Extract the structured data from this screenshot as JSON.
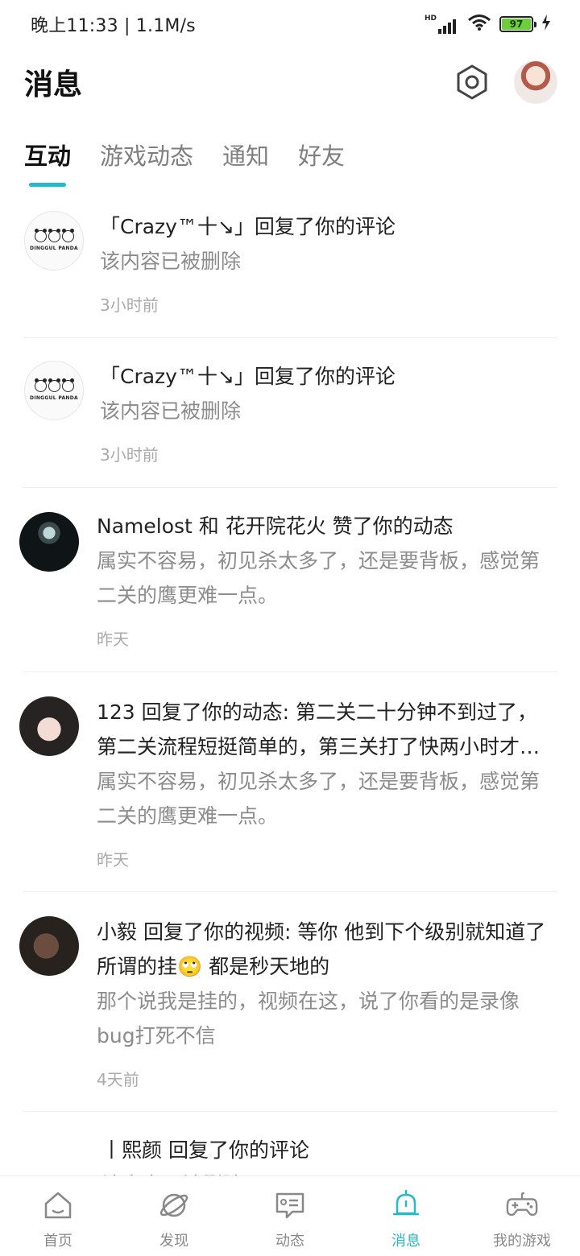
{
  "status_bar": {
    "time_speed": "晚上11:33 | 1.1M/s",
    "signal_label": "HD",
    "battery": "97"
  },
  "header": {
    "title": "消息"
  },
  "tabs": [
    "互动",
    "游戏动态",
    "通知",
    "好友"
  ],
  "messages": [
    {
      "title": "「Crazy™十↘」回复了你的评论",
      "content": "该内容已被删除",
      "time": "3小时前",
      "avatar_text": "DINGGUL PANDA"
    },
    {
      "title": "「Crazy™十↘」回复了你的评论",
      "content": "该内容已被删除",
      "time": "3小时前",
      "avatar_text": "DINGGUL PANDA"
    },
    {
      "title": "Namelost 和 花开院花火 赞了你的动态",
      "content": "属实不容易，初见杀太多了，还是要背板，感觉第二关的鹰更难一点。",
      "time": "昨天"
    },
    {
      "title": "123 回复了你的动态: 第二关二十分钟不到过了，第二关流程短挺简单的，第三关打了快两小时才…",
      "content": "属实不容易，初见杀太多了，还是要背板，感觉第二关的鹰更难一点。",
      "time": "昨天"
    },
    {
      "title": "小毅 回复了你的视频: 等你 他到下个级别就知道了   所谓的挂🙄   都是秒天地的",
      "content": "那个说我是挂的，视频在这，说了你看的是录像bug打死不信",
      "time": "4天前"
    },
    {
      "title": "丨熙颜 回复了你的评论",
      "content": "该内容已被删除"
    }
  ],
  "bottom_nav": [
    "首页",
    "发现",
    "动态",
    "消息",
    "我的游戏"
  ],
  "colors": {
    "accent": "#27b9c8",
    "text_primary": "#222222",
    "text_secondary": "#8c8c8c",
    "text_time": "#aaaaaa"
  }
}
